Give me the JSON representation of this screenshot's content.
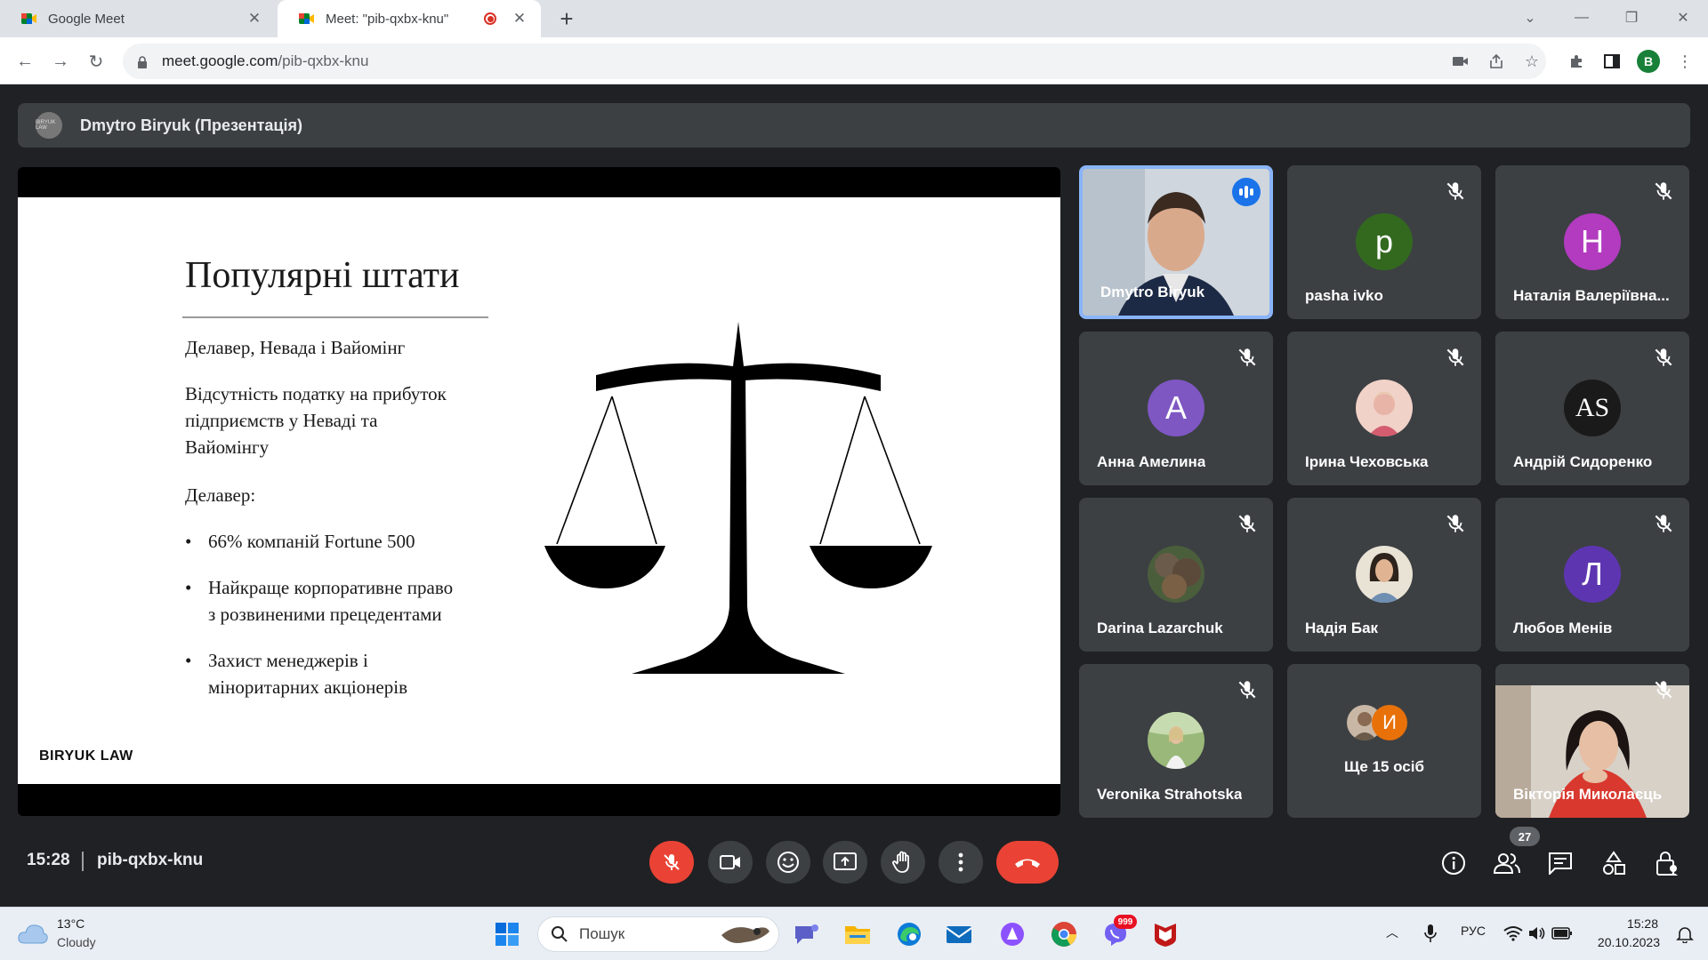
{
  "browser": {
    "tabs": [
      {
        "title": "Google Meet",
        "active": false
      },
      {
        "title": "Meet: \"pib-qxbx-knu\"",
        "active": true,
        "recording": true
      }
    ],
    "url_host": "meet.google.com",
    "url_path": "/pib-qxbx-knu",
    "profile_initial": "B"
  },
  "meet": {
    "presenter_label": "Dmytro Biryuk (Презентація)",
    "presenter_avatar_text": "BIRYUK LAW",
    "slide": {
      "title": "Популярні штати",
      "lines": [
        "Делавер, Невада і Вайомінг",
        "Відсутність податку на прибуток",
        "підприємств у Неваді та",
        "Вайомінгу",
        "Делавер:"
      ],
      "bullets": [
        [
          "66% компаній Fortune 500"
        ],
        [
          "Найкраще корпоративне право",
          "з розвиненими прецедентами"
        ],
        [
          "Захист менеджерів і",
          "міноритарних акціонерів"
        ]
      ],
      "brand": "BIRYUK LAW"
    },
    "participants": [
      {
        "name": "Dmytro Biryuk",
        "type": "video-man",
        "speaking": true
      },
      {
        "name": "pasha ivko",
        "type": "letter",
        "letter": "p",
        "color": "#33691e"
      },
      {
        "name": "Наталія Валеріївна...",
        "type": "letter",
        "letter": "Н",
        "color": "#b23bbf"
      },
      {
        "name": "Анна Амелина",
        "type": "letter",
        "letter": "А",
        "color": "#7e57c2"
      },
      {
        "name": "Ірина Чеховська",
        "type": "photo",
        "tone": "#e8b4a8"
      },
      {
        "name": "Андрій Сидоренко",
        "type": "monogram",
        "letter": "AS",
        "color": "#1a1a1a"
      },
      {
        "name": "Darina Lazarchuk",
        "type": "photo",
        "tone": "#5b4a3a"
      },
      {
        "name": "Надія Бак",
        "type": "photo",
        "tone": "#c9a27a"
      },
      {
        "name": "Любов Менів",
        "type": "letter",
        "letter": "Л",
        "color": "#5e35b1"
      },
      {
        "name": "Veronika Strahotska",
        "type": "photo",
        "tone": "#8fae6a"
      },
      {
        "name": "Ще 15 осіб",
        "type": "more",
        "letter": "И",
        "color": "#e8710a"
      },
      {
        "name": "Вікторія Миколаєць",
        "type": "video-woman"
      }
    ],
    "clock": "15:28",
    "meeting_code": "pib-qxbx-knu",
    "people_count": "27"
  },
  "taskbar": {
    "temperature": "13°C",
    "weather": "Cloudy",
    "search_placeholder": "Пошук",
    "language": "РУС",
    "time": "15:28",
    "date": "20.10.2023",
    "viber_badge": "999"
  },
  "colors": {
    "meet_bg": "#202124",
    "tile_bg": "#3c4043",
    "end_call": "#ea4335",
    "speaking_border": "#8ab4f8"
  }
}
